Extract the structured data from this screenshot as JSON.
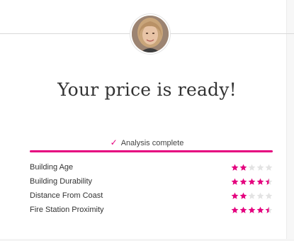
{
  "header": {
    "avatar_icon": "user-portrait"
  },
  "main": {
    "title": "Your price is ready!",
    "status_text": "Analysis complete",
    "status_icon": "checkmark-icon",
    "progress_fraction": 1.0
  },
  "ratings": [
    {
      "label": "Building Age",
      "stars": 2,
      "max": 5
    },
    {
      "label": "Building Durability",
      "stars": 4.5,
      "max": 5
    },
    {
      "label": "Distance From Coast",
      "stars": 2,
      "max": 5
    },
    {
      "label": "Fire Station Proximity",
      "stars": 4.5,
      "max": 5
    }
  ],
  "colors": {
    "accent": "#e5007e",
    "star_empty": "#e3e3e3",
    "text": "#333333"
  }
}
